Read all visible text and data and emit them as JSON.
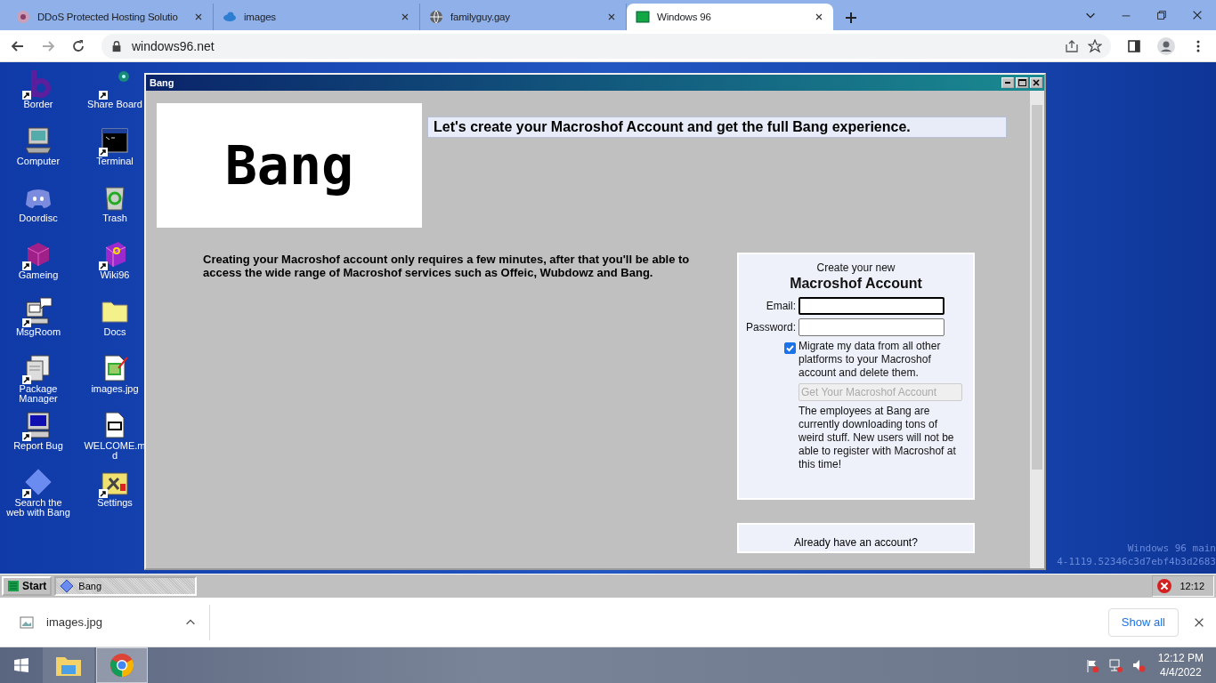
{
  "browser": {
    "tabs": [
      {
        "title": "DDoS Protected Hosting Solutio",
        "kind": "flower",
        "selected": false
      },
      {
        "title": "images",
        "kind": "cloud",
        "selected": false
      },
      {
        "title": "familyguy.gay",
        "kind": "globe",
        "selected": false
      },
      {
        "title": "Windows 96",
        "kind": "win96",
        "selected": true
      }
    ],
    "url": "windows96.net"
  },
  "desktop": {
    "icons": [
      {
        "label": "Border",
        "kind": "letter-b",
        "shortcut": true
      },
      {
        "label": "Share Board",
        "kind": "dot",
        "shortcut": true
      },
      {
        "label": "Computer",
        "kind": "computer",
        "shortcut": false
      },
      {
        "label": "Terminal",
        "kind": "terminal",
        "shortcut": true
      },
      {
        "label": "Doordisc",
        "kind": "chat",
        "shortcut": false
      },
      {
        "label": "Trash",
        "kind": "trash",
        "shortcut": false
      },
      {
        "label": "Gameing",
        "kind": "cube",
        "shortcut": true
      },
      {
        "label": "Wiki96",
        "kind": "book",
        "shortcut": true
      },
      {
        "label": "MsgRoom",
        "kind": "msgroom",
        "shortcut": true
      },
      {
        "label": "Docs",
        "kind": "folder",
        "shortcut": false
      },
      {
        "label": "Package Manager",
        "kind": "package",
        "shortcut": true
      },
      {
        "label": "images.jpg",
        "kind": "image",
        "shortcut": false
      },
      {
        "label": "Report Bug",
        "kind": "monitor",
        "shortcut": true
      },
      {
        "label": "WELCOME.md",
        "kind": "markdown",
        "shortcut": false
      },
      {
        "label": "Search the web with Bang",
        "kind": "diamond",
        "shortcut": true
      },
      {
        "label": "Settings",
        "kind": "settings",
        "shortcut": true
      }
    ],
    "build_info": [
      "Windows 96 main",
      "4-1119.52346c3d7ebf4b3d2683"
    ]
  },
  "window": {
    "title": "Bang",
    "logo": "Bang",
    "headline": "Let's create your Macroshof Account and get the full Bang experience.",
    "intro": "Creating your Macroshof account only requires a few minutes, after that you'll be able to access the wide range of Macroshof services such as Offeic, Wubdowz and Bang.",
    "form": {
      "subtitle": "Create your new",
      "title": "Macroshof Account",
      "fields": [
        {
          "label": "Email:",
          "focused": true
        },
        {
          "label": "Password:",
          "focused": false
        }
      ],
      "migrate": {
        "label": "Migrate my data from all other platforms to your Macroshof account and delete them.",
        "checked": true
      },
      "submit": {
        "label": "Get Your Macroshof Account",
        "disabled": true
      },
      "notice": "The employees at Bang are currently downloading tons of weird stuff. New users will not be able to register with Macroshof at this time!"
    },
    "login_prompt": "Already have an account?"
  },
  "taskbar": {
    "start": "Start",
    "tasks": [
      {
        "label": "Bang",
        "selected": true
      }
    ],
    "clock": "12:12"
  },
  "downloads": {
    "items": [
      {
        "name": "images.jpg"
      }
    ],
    "show_all": "Show all"
  },
  "os_taskbar": {
    "apps": [
      {
        "kind": "explorer",
        "selected": false
      },
      {
        "kind": "chrome",
        "selected": true
      }
    ],
    "time": "12:12 PM",
    "date": "4/4/2022"
  }
}
